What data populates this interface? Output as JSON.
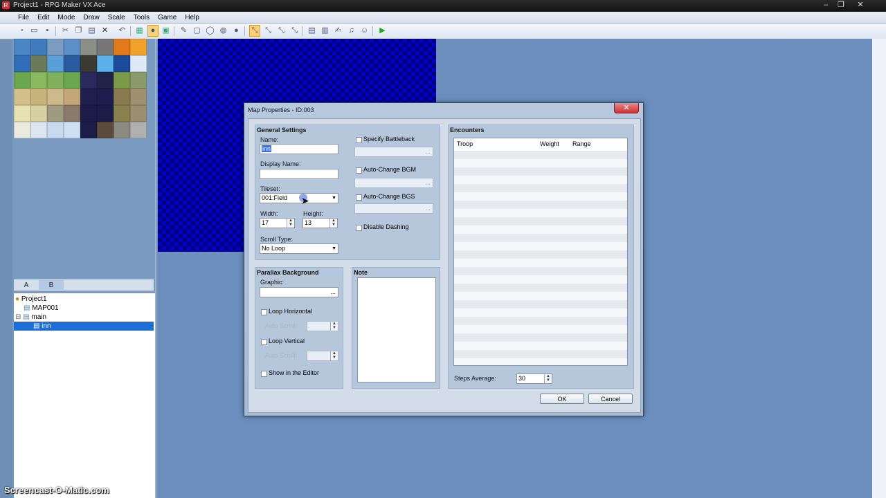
{
  "window": {
    "title": "Project1 - RPG Maker VX Ace",
    "app_icon": "rpgmaker-icon",
    "controls": {
      "minimize": "–",
      "restore": "❐",
      "close": "✕"
    }
  },
  "menu": [
    "File",
    "Edit",
    "Mode",
    "Draw",
    "Scale",
    "Tools",
    "Game",
    "Help"
  ],
  "toolbar": {
    "icons": [
      "new-project-icon",
      "open-project-icon",
      "save-icon",
      "cut-icon",
      "copy-icon",
      "paste-icon",
      "delete-icon",
      "undo-icon",
      "map-layer-icon",
      "event-layer-icon",
      "region-layer-icon",
      "pencil-icon",
      "rectangle-icon",
      "ellipse-icon",
      "fill-icon",
      "shadow-pen-icon",
      "scale-1-icon",
      "scale-2-icon",
      "scale-4-icon",
      "scale-8-icon",
      "database-icon",
      "resource-manager-icon",
      "script-editor-icon",
      "sound-test-icon",
      "character-generator-icon",
      "playtest-icon"
    ]
  },
  "tileset_tabs": {
    "a": "A",
    "b": "B"
  },
  "map_tree": {
    "project": "Project1",
    "items": [
      "MAP001",
      "main",
      "inn"
    ]
  },
  "dialog": {
    "title": "Map Properties - ID:003",
    "close": "✕",
    "general": {
      "title": "General Settings",
      "name_label": "Name:",
      "name_value": "inn",
      "display_name_label": "Display Name:",
      "display_name_value": "",
      "tileset_label": "Tileset:",
      "tileset_value": "001:Field",
      "width_label": "Width:",
      "width_value": "17",
      "height_label": "Height:",
      "height_value": "13",
      "scroll_type_label": "Scroll Type:",
      "scroll_type_value": "No Loop",
      "specify_battleback": "Specify Battleback",
      "auto_change_bgm": "Auto-Change BGM",
      "auto_change_bgs": "Auto-Change BGS",
      "disable_dashing": "Disable Dashing",
      "ellipsis": "..."
    },
    "parallax": {
      "title": "Parallax Background",
      "graphic_label": "Graphic:",
      "graphic_value": "",
      "ellipsis": "...",
      "loop_horizontal": "Loop Horizontal",
      "loop_vertical": "Loop Vertical",
      "auto_scroll": "Auto Scroll:",
      "show_in_editor": "Show in the Editor"
    },
    "note": {
      "title": "Note",
      "value": ""
    },
    "encounters": {
      "title": "Encounters",
      "columns": [
        "Troop",
        "Weight",
        "Range"
      ],
      "steps_label": "Steps Average:",
      "steps_value": "30"
    },
    "ok": "OK",
    "cancel": "Cancel"
  },
  "watermark": "Screencast-O-Matic.com"
}
